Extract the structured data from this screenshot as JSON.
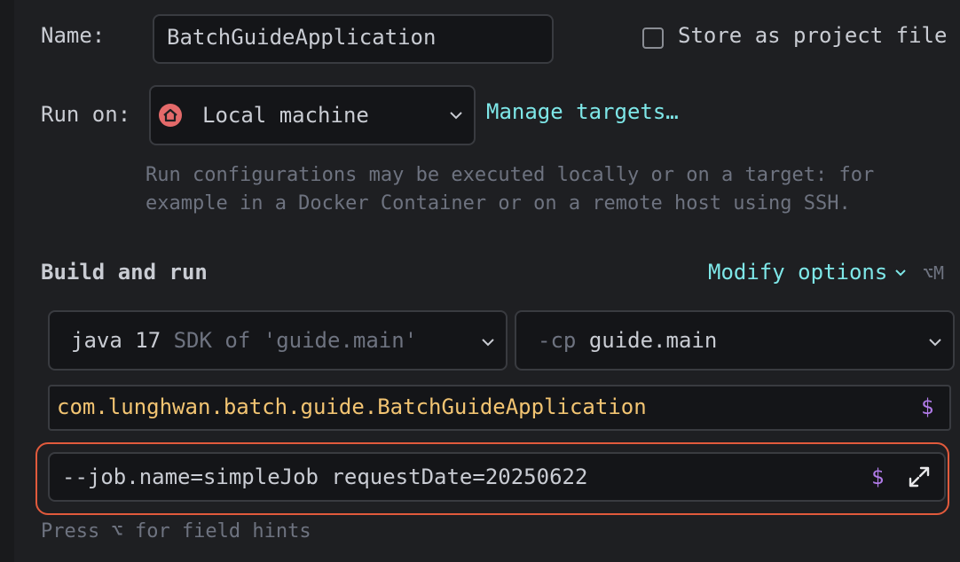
{
  "name": {
    "label": "Name:",
    "value": "BatchGuideApplication"
  },
  "store": {
    "label": "Store as project file",
    "checked": false
  },
  "run_on": {
    "label": "Run on:",
    "value": "Local machine",
    "icon": "home-icon",
    "manage_link": "Manage targets…"
  },
  "hint": {
    "line1": "Run configurations may be executed locally or on a target: for",
    "line2": "example in a Docker Container or on a remote host using SSH."
  },
  "build": {
    "title": "Build and run",
    "modify_label": "Modify options",
    "modify_shortcut": "⌥M"
  },
  "sdk": {
    "prefix": "java 17",
    "suffix": "SDK of 'guide.main'"
  },
  "classpath": {
    "flag": "-cp",
    "module": "guide.main"
  },
  "main_class": {
    "value": "com.lunghwan.batch.guide.BatchGuideApplication",
    "macro_symbol": "$"
  },
  "program_args": {
    "value": "--job.name=simpleJob requestDate=20250622",
    "macro_symbol": "$"
  },
  "footer": {
    "text": "Press ⌥ for field hints"
  },
  "colors": {
    "accent_link": "#7ee7e8",
    "class_text": "#f2c472",
    "macro": "#b17be8",
    "highlight_outline": "#e15a3c"
  }
}
